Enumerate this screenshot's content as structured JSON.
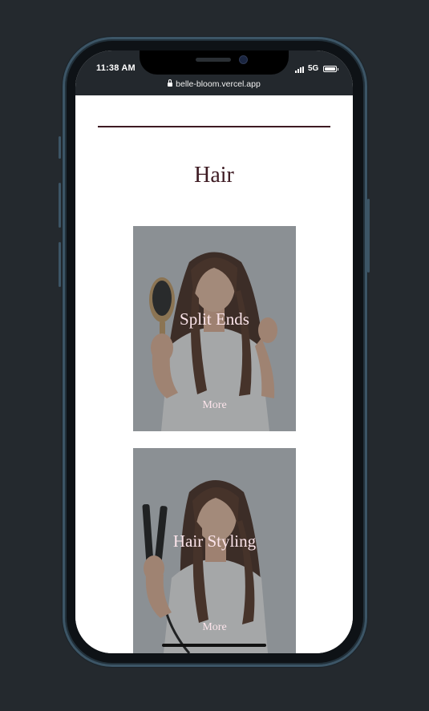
{
  "status_bar": {
    "time": "11:38 AM",
    "network": "5G",
    "url": "belle-bloom.vercel.app",
    "icons": [
      "signal-icon",
      "battery-icon",
      "lock-icon"
    ]
  },
  "page": {
    "heading": "Hair",
    "cards": [
      {
        "title": "Split Ends",
        "more_label": "More",
        "image": "woman-holding-hairbrush"
      },
      {
        "title": "Hair Styling",
        "more_label": "More",
        "image": "woman-holding-hair-straightener"
      }
    ]
  },
  "colors": {
    "backdrop": "#24292e",
    "accent": "#3d1a22",
    "card_text": "#fbe4ea",
    "phone_frame": "#3c5566"
  }
}
